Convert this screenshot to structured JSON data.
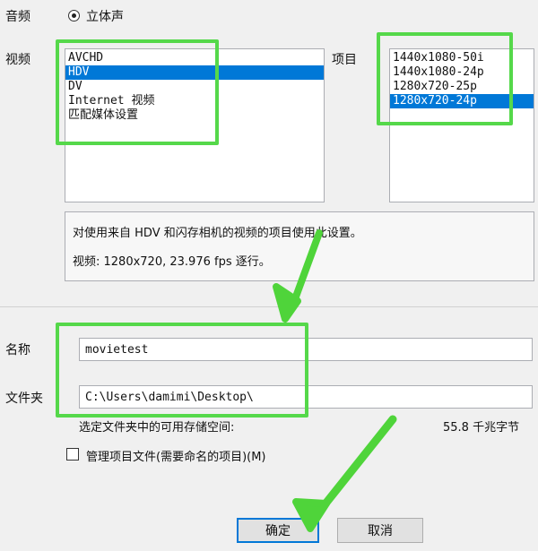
{
  "audio": {
    "label": "音频",
    "option": "立体声"
  },
  "video": {
    "label": "视频",
    "formats": [
      "AVCHD",
      "HDV",
      "DV",
      "Internet 视频",
      "匹配媒体设置"
    ],
    "selected_index": 1
  },
  "items": {
    "label": "项目",
    "presets": [
      "1440x1080-50i",
      "1440x1080-24p",
      "1280x720-25p",
      "1280x720-24p"
    ],
    "selected_index": 3
  },
  "description": {
    "line1": "对使用来自 HDV 和闪存相机的视频的项目使用此设置。",
    "line2": "视频: 1280x720, 23.976 fps 逐行。"
  },
  "name": {
    "label": "名称",
    "value": "movietest"
  },
  "folder": {
    "label": "文件夹",
    "value": "C:\\Users\\damimi\\Desktop\\"
  },
  "space": {
    "label": "选定文件夹中的可用存储空间:",
    "value": "55.8 千兆字节"
  },
  "manage": {
    "label": "管理项目文件(需要命名的项目)(M)"
  },
  "buttons": {
    "ok": "确定",
    "cancel": "取消"
  },
  "colors": {
    "highlight": "#55d84a",
    "selection": "#0078d7",
    "arrow": "#4fd43a"
  }
}
